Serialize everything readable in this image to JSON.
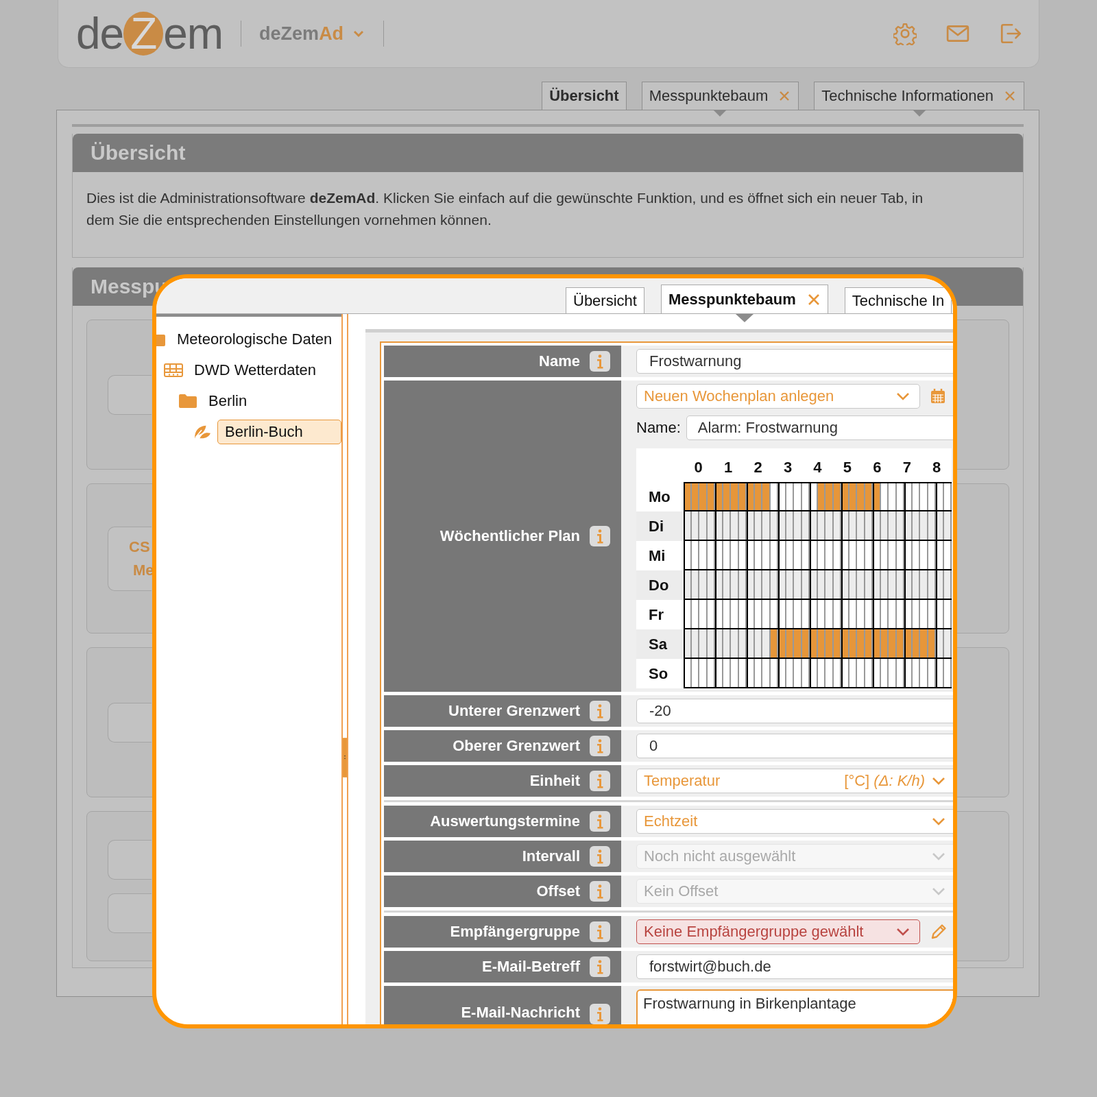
{
  "header": {
    "logo": "deZem",
    "app": {
      "name": "deZem",
      "suffix": "Ad"
    }
  },
  "tabs": [
    {
      "label": "Übersicht",
      "selected": true,
      "closable": false
    },
    {
      "label": "Messpunktebaum",
      "selected": false,
      "closable": true
    },
    {
      "label": "Technische Informationen",
      "selected": false,
      "closable": true
    }
  ],
  "overview": {
    "title": "Übersicht",
    "text": "Dies ist die Administrationsoftware **deZemAd**. Klicken Sie einfach auf die gewünschte Funktion, und es öffnet sich ein neuer Tab, in dem Sie die entsprechenden Einstellungen vornehmen können."
  },
  "measuring_section": {
    "title": "Messpu",
    "cards": [
      {
        "buttons": [
          {
            "kind": "button"
          }
        ]
      },
      {
        "buttons": [
          {
            "kind": "button",
            "lines": [
              "CS",
              "Me"
            ]
          }
        ]
      },
      {
        "buttons": [
          {
            "kind": "button"
          }
        ]
      },
      {
        "buttons": [
          {
            "kind": "button"
          },
          {
            "kind": "button"
          }
        ]
      }
    ]
  },
  "zoom_view": {
    "tabs": [
      {
        "label": "Übersicht",
        "selected": false,
        "closable": false
      },
      {
        "label": "Messpunktebaum",
        "selected": true,
        "closable": true
      },
      {
        "label": "Technische In",
        "selected": false,
        "closable": false
      }
    ],
    "tree": [
      {
        "label": "Meteorologische Daten",
        "kind": "folder",
        "selected": false,
        "children": [
          {
            "label": "DWD Wetterdaten",
            "kind": "grid",
            "selected": false,
            "children": [
              {
                "label": "Berlin",
                "kind": "folder",
                "selected": false,
                "children": [
                  {
                    "label": "Berlin-Buch",
                    "kind": "station",
                    "selected": true
                  }
                ]
              }
            ]
          }
        ]
      }
    ],
    "form": {
      "groups": [
        {
          "rows": [
            {
              "label": "Name",
              "field": {
                "kind": "input",
                "value": "Frostwarnung"
              }
            },
            {
              "label": "Wöchentlicher Plan",
              "field": {
                "kind": "schedule",
                "plan_select": "Neuen Wochenplan anlegen",
                "name_label": "Name:",
                "name_value": "Alarm: Frostwarnung",
                "hours": [
                  "0",
                  "1",
                  "2",
                  "3",
                  "4",
                  "5",
                  "6",
                  "7",
                  "8"
                ],
                "days": [
                  {
                    "label": "Mo",
                    "slots": [
                      true,
                      true,
                      true,
                      true,
                      true,
                      true,
                      true,
                      true,
                      true,
                      true,
                      true,
                      false,
                      false,
                      false,
                      false,
                      false,
                      false,
                      true,
                      true,
                      true,
                      true,
                      true,
                      true,
                      true,
                      true,
                      false,
                      false,
                      false,
                      false,
                      false,
                      false,
                      false,
                      false,
                      false
                    ]
                  },
                  {
                    "label": "Di",
                    "slots": [
                      false,
                      false,
                      false,
                      false,
                      false,
                      false,
                      false,
                      false,
                      false,
                      false,
                      false,
                      false,
                      false,
                      false,
                      false,
                      false,
                      false,
                      false,
                      false,
                      false,
                      false,
                      false,
                      false,
                      false,
                      false,
                      false,
                      false,
                      false,
                      false,
                      false,
                      false,
                      false,
                      false,
                      false
                    ]
                  },
                  {
                    "label": "Mi",
                    "slots": [
                      false,
                      false,
                      false,
                      false,
                      false,
                      false,
                      false,
                      false,
                      false,
                      false,
                      false,
                      false,
                      false,
                      false,
                      false,
                      false,
                      false,
                      false,
                      false,
                      false,
                      false,
                      false,
                      false,
                      false,
                      false,
                      false,
                      false,
                      false,
                      false,
                      false,
                      false,
                      false,
                      false,
                      false
                    ]
                  },
                  {
                    "label": "Do",
                    "slots": [
                      false,
                      false,
                      false,
                      false,
                      false,
                      false,
                      false,
                      false,
                      false,
                      false,
                      false,
                      false,
                      false,
                      false,
                      false,
                      false,
                      false,
                      false,
                      false,
                      false,
                      false,
                      false,
                      false,
                      false,
                      false,
                      false,
                      false,
                      false,
                      false,
                      false,
                      false,
                      false,
                      false,
                      false
                    ]
                  },
                  {
                    "label": "Fr",
                    "slots": [
                      false,
                      false,
                      false,
                      false,
                      false,
                      false,
                      false,
                      false,
                      false,
                      false,
                      false,
                      false,
                      false,
                      false,
                      false,
                      false,
                      false,
                      false,
                      false,
                      false,
                      false,
                      false,
                      false,
                      false,
                      false,
                      false,
                      false,
                      false,
                      false,
                      false,
                      false,
                      false,
                      false,
                      false
                    ]
                  },
                  {
                    "label": "Sa",
                    "slots": [
                      false,
                      false,
                      false,
                      false,
                      false,
                      false,
                      false,
                      false,
                      false,
                      false,
                      false,
                      true,
                      true,
                      true,
                      true,
                      true,
                      true,
                      true,
                      true,
                      true,
                      true,
                      true,
                      true,
                      true,
                      true,
                      true,
                      true,
                      true,
                      true,
                      true,
                      true,
                      true,
                      false,
                      false
                    ]
                  },
                  {
                    "label": "So",
                    "slots": [
                      false,
                      false,
                      false,
                      false,
                      false,
                      false,
                      false,
                      false,
                      false,
                      false,
                      false,
                      false,
                      false,
                      false,
                      false,
                      false,
                      false,
                      false,
                      false,
                      false,
                      false,
                      false,
                      false,
                      false,
                      false,
                      false,
                      false,
                      false,
                      false,
                      false,
                      false,
                      false,
                      false,
                      false
                    ]
                  }
                ]
              }
            },
            {
              "label": "Unterer Grenzwert",
              "field": {
                "kind": "input",
                "value": "-20"
              }
            },
            {
              "label": "Oberer Grenzwert",
              "field": {
                "kind": "input",
                "value": "0"
              }
            },
            {
              "label": "Einheit",
              "field": {
                "kind": "select",
                "value": "Temperatur",
                "unit": "[°C]",
                "unit_note": "(Δ: K/h)",
                "disabled": false,
                "invalid": false,
                "editable": false
              }
            }
          ]
        },
        {
          "rows": [
            {
              "label": "Auswertungstermine",
              "field": {
                "kind": "select",
                "value": "Echtzeit",
                "disabled": false,
                "invalid": false,
                "editable": false
              }
            },
            {
              "label": "Intervall",
              "field": {
                "kind": "select",
                "value": "Noch nicht ausgewählt",
                "disabled": true,
                "invalid": false,
                "editable": false
              }
            },
            {
              "label": "Offset",
              "field": {
                "kind": "select",
                "value": "Kein Offset",
                "disabled": true,
                "invalid": false,
                "editable": false
              }
            }
          ]
        },
        {
          "rows": [
            {
              "label": "Empfängergruppe",
              "field": {
                "kind": "select",
                "value": "Keine Empfängergruppe gewählt",
                "disabled": false,
                "invalid": true,
                "editable": true
              }
            },
            {
              "label": "E-Mail-Betreff",
              "field": {
                "kind": "input",
                "value": "forstwirt@buch.de"
              }
            },
            {
              "label": "E-Mail-Nachricht",
              "field": {
                "kind": "textarea",
                "value": "Frostwarnung in Birkenplantage",
                "focused": true
              }
            }
          ]
        }
      ]
    }
  }
}
